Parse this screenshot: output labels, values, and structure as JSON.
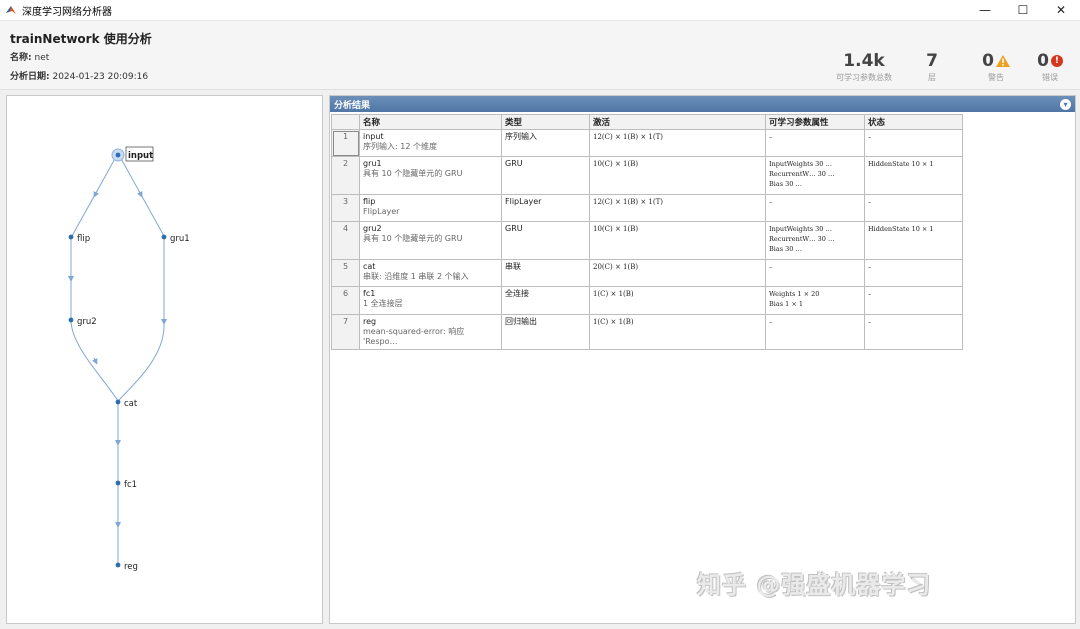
{
  "window": {
    "title": "深度学习网络分析器",
    "controls": [
      "—",
      "☐",
      "✕"
    ]
  },
  "header": {
    "title": "trainNetwork 使用分析",
    "name_label": "名称:",
    "name_value": "net",
    "date_label": "分析日期:",
    "date_value": "2024-01-23 20:09:16"
  },
  "stats": [
    {
      "value": "1.4k",
      "label": "可学习参数总数"
    },
    {
      "value": "7",
      "label": "层"
    },
    {
      "value": "0",
      "label": "警告"
    },
    {
      "value": "0",
      "label": "错误"
    }
  ],
  "graph": {
    "nodes": [
      {
        "id": "input",
        "label": "input",
        "selected": true
      },
      {
        "id": "flip",
        "label": "flip"
      },
      {
        "id": "gru1",
        "label": "gru1"
      },
      {
        "id": "gru2",
        "label": "gru2"
      },
      {
        "id": "cat",
        "label": "cat"
      },
      {
        "id": "fc1",
        "label": "fc1"
      },
      {
        "id": "reg",
        "label": "reg"
      }
    ]
  },
  "results": {
    "title": "分析结果",
    "columns": [
      "名称",
      "类型",
      "激活",
      "可学习参数属性",
      "状态"
    ],
    "rows": [
      {
        "index": "1",
        "name": "input",
        "desc": "序列输入: 12 个维度",
        "type": "序列输入",
        "activation": "12(C) × 1(B) × 1(T)",
        "learnables": [
          "–"
        ],
        "state": [
          "–"
        ]
      },
      {
        "index": "2",
        "name": "gru1",
        "desc": "具有 10 个隐藏单元的 GRU",
        "type": "GRU",
        "activation": "10(C) × 1(B)",
        "learnables": [
          "InputWeights  30 …",
          "RecurrentW…  30 …",
          "Bias         30 …"
        ],
        "state": [
          "HiddenState  10 × 1"
        ]
      },
      {
        "index": "3",
        "name": "flip",
        "desc": "FlipLayer",
        "type": "FlipLayer",
        "activation": "12(C) × 1(B) × 1(T)",
        "learnables": [
          "–"
        ],
        "state": [
          "–"
        ]
      },
      {
        "index": "4",
        "name": "gru2",
        "desc": "具有 10 个隐藏单元的 GRU",
        "type": "GRU",
        "activation": "10(C) × 1(B)",
        "learnables": [
          "InputWeights  30 …",
          "RecurrentW…  30 …",
          "Bias         30 …"
        ],
        "state": [
          "HiddenState  10 × 1"
        ]
      },
      {
        "index": "5",
        "name": "cat",
        "desc": "串联: 沿维度 1 串联 2 个输入",
        "type": "串联",
        "activation": "20(C) × 1(B)",
        "learnables": [
          "–"
        ],
        "state": [
          "–"
        ]
      },
      {
        "index": "6",
        "name": "fc1",
        "desc": "1 全连接层",
        "type": "全连接",
        "activation": "1(C) × 1(B)",
        "learnables": [
          "Weights  1 × 20",
          "Bias     1 × 1"
        ],
        "state": [
          "–"
        ]
      },
      {
        "index": "7",
        "name": "reg",
        "desc": "mean-squared-error: 响应 'Respo…",
        "type": "回归输出",
        "activation": "1(C) × 1(B)",
        "learnables": [
          "–"
        ],
        "state": [
          "–"
        ]
      }
    ]
  },
  "watermark": "知乎 @强盛机器学习",
  "colors": {
    "accent": "#4f76a6",
    "node": "#2f6db3",
    "edge": "#7fa7d6",
    "warning": "#f0a020",
    "error": "#d6361d"
  }
}
